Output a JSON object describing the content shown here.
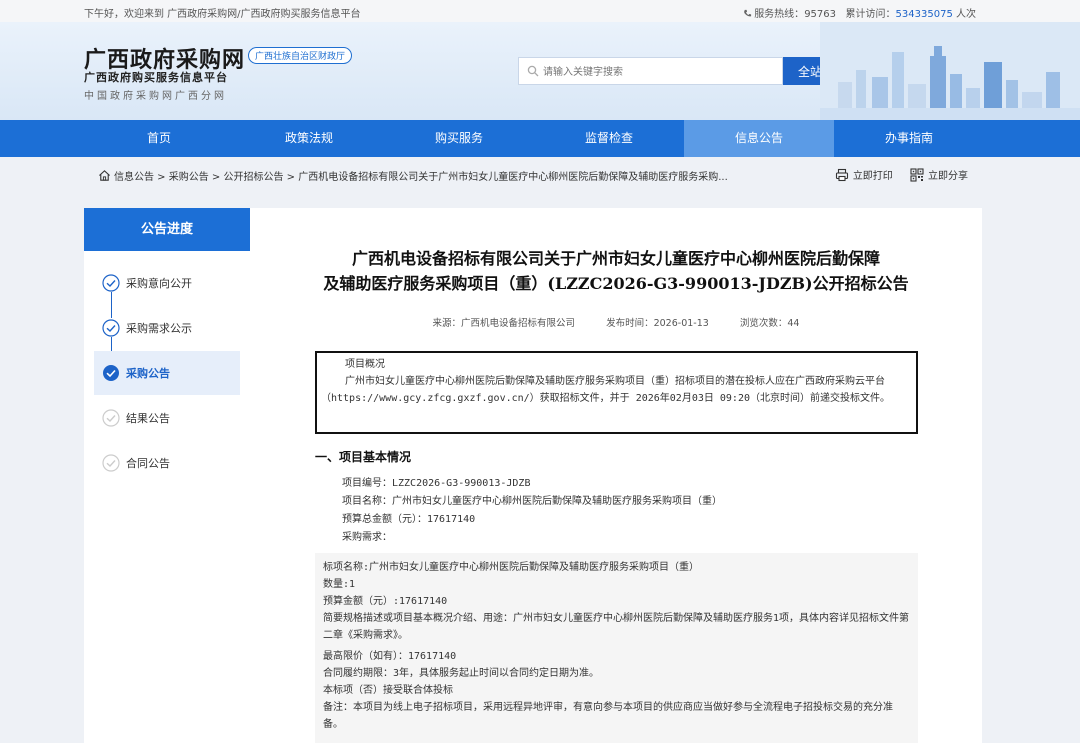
{
  "topbar": {
    "greeting": "下午好，欢迎来到 广西政府采购网/广西政府购买服务信息平台",
    "hotline_label": "服务热线：",
    "hotline": "95763",
    "visits_label": "累计访问：",
    "visits": "534335075",
    "visits_unit": " 人次"
  },
  "header": {
    "title": "广西政府采购网",
    "badge": "广西壮族自治区财政厅",
    "subtitle": "广西政府购买服务信息平台",
    "subtitle2": "中国政府采购网广西分网",
    "search_placeholder": "请输入关键字搜索",
    "search_button": "全站搜索"
  },
  "nav": {
    "items": [
      {
        "label": "首页"
      },
      {
        "label": "政策法规"
      },
      {
        "label": "购买服务"
      },
      {
        "label": "监督检查"
      },
      {
        "label": "信息公告"
      },
      {
        "label": "办事指南"
      }
    ]
  },
  "breadcrumb": {
    "items": [
      "信息公告",
      "采购公告",
      "公开招标公告",
      "广西机电设备招标有限公司关于广州市妇女儿童医疗中心柳州医院后勤保障及辅助医疗服务采购..."
    ],
    "sep": " > "
  },
  "actions": {
    "print": "立即打印",
    "share": "立即分享"
  },
  "sidebar": {
    "title": "公告进度",
    "steps": [
      {
        "label": "采购意向公开",
        "state": "done"
      },
      {
        "label": "采购需求公示",
        "state": "done"
      },
      {
        "label": "采购公告",
        "state": "active"
      },
      {
        "label": "结果公告",
        "state": "pending"
      },
      {
        "label": "合同公告",
        "state": "pending"
      }
    ]
  },
  "article": {
    "title_line1": "广西机电设备招标有限公司关于广州市妇女儿童医疗中心柳州医院后勤保障",
    "title_line2": "及辅助医疗服务采购项目（重）(LZZC2026-G3-990013-JDZB)公开招标公告",
    "source": "来源：广西机电设备招标有限公司",
    "publish_time": "发布时间：2026-01-13",
    "views": "浏览次数：44",
    "overview_heading": "项目概况",
    "overview_text": "广州市妇女儿童医疗中心柳州医院后勤保障及辅助医疗服务采购项目（重）招标项目的潜在投标人应在广西政府采购云平台（https://www.gcy.zfcg.gxzf.gov.cn/）获取招标文件，并于 2026年02月03日 09:20（北京时间）前递交投标文件。",
    "section1": "一、项目基本情况",
    "project_no": "项目编号：LZZC2026-G3-990013-JDZB",
    "project_name": "项目名称：广州市妇女儿童医疗中心柳州医院后勤保障及辅助医疗服务采购项目（重）",
    "budget": "预算总金额（元）：17617140",
    "requirement": "采购需求：",
    "lot_name": "标项名称:广州市妇女儿童医疗中心柳州医院后勤保障及辅助医疗服务采购项目（重）",
    "quantity": "数量:1",
    "lot_budget": "预算金额（元）:17617140",
    "desc": "简要规格描述或项目基本概况介绍、用途：广州市妇女儿童医疗中心柳州医院后勤保障及辅助医疗服务1项，具体内容详见招标文件第二章《采购需求》。",
    "max_price": "最高限价（如有）：17617140",
    "period": "合同履约期限：3年，具体服务起止时间以合同约定日期为准。",
    "consortium": "本标项（否）接受联合体投标",
    "remark": "备注：本项目为线上电子招标项目，采用远程异地评审，有意向参与本项目的供应商应当做好参与全流程电子招投标交易的充分准备。"
  },
  "colors": {
    "primary": "#1c6fd6",
    "nav_active": "#5b9be6",
    "link": "#1d63c8"
  }
}
